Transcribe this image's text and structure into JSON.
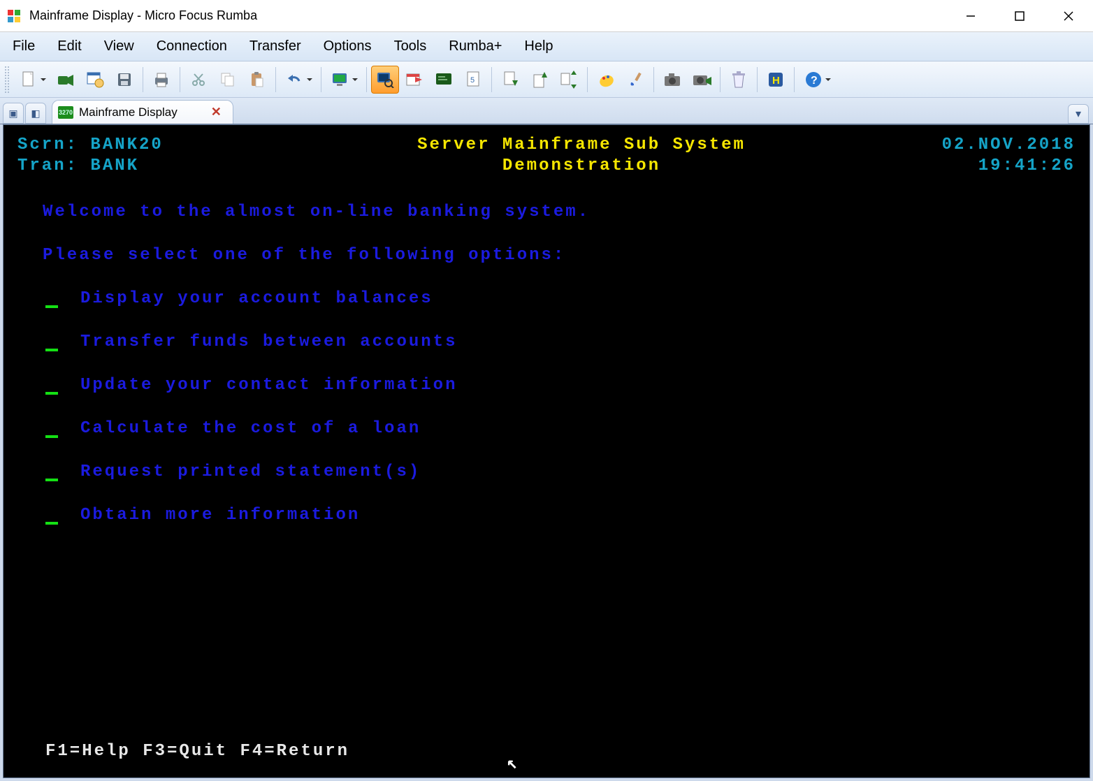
{
  "window": {
    "title": "Mainframe Display - Micro Focus Rumba"
  },
  "menu": [
    "File",
    "Edit",
    "View",
    "Connection",
    "Transfer",
    "Options",
    "Tools",
    "Rumba+",
    "Help"
  ],
  "tab": {
    "label": "Mainframe Display",
    "badge": "3270"
  },
  "terminal": {
    "scrn_label": "Scrn:",
    "scrn_value": "BANK20",
    "tran_label": "Tran:",
    "tran_value": "BANK",
    "title_line1": "Server Mainframe Sub System",
    "title_line2": "Demonstration",
    "date": "02.NOV.2018",
    "time": "19:41:26",
    "welcome": "Welcome to the almost on-line banking system.",
    "prompt": "Please select one of the following options:",
    "options": [
      "Display your account balances",
      "Transfer funds between accounts",
      "Update your contact information",
      "Calculate the cost of a loan",
      "Request printed statement(s)",
      "Obtain more information"
    ],
    "fnkeys": "F1=Help F3=Quit F4=Return"
  }
}
